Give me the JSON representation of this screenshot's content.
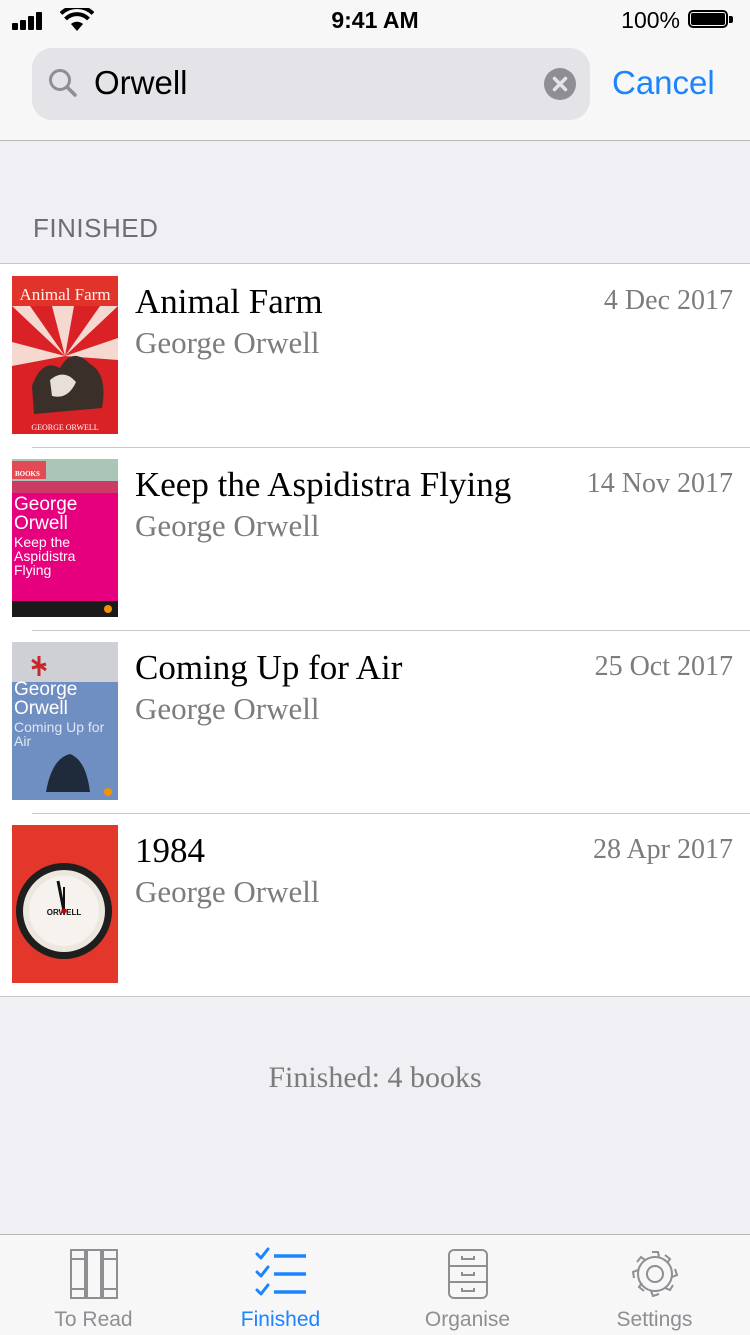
{
  "status_bar": {
    "time": "9:41 AM",
    "battery": "100%"
  },
  "search": {
    "query": "Orwell",
    "cancel_label": "Cancel"
  },
  "section": {
    "title": "FINISHED"
  },
  "books": [
    {
      "title": "Animal Farm",
      "author": "George Orwell",
      "date": "4 Dec 2017"
    },
    {
      "title": "Keep the Aspidistra Flying",
      "author": "George Orwell",
      "date": "14 Nov 2017"
    },
    {
      "title": "Coming Up for Air",
      "author": "George Orwell",
      "date": "25 Oct 2017"
    },
    {
      "title": "1984",
      "author": "George Orwell",
      "date": "28 Apr 2017"
    }
  ],
  "covers": {
    "animal_farm": {
      "heading": "Animal Farm",
      "footer": "GEORGE ORWELL"
    },
    "aspidistra": {
      "publisher": "BOOKS",
      "author": "George Orwell",
      "title": "Keep the Aspidistra Flying"
    },
    "coming_up": {
      "author": "George Orwell",
      "title": "Coming Up for Air"
    },
    "nineteen_84": {
      "clock_label": "ORWELL"
    }
  },
  "footer": {
    "count_text": "Finished: 4 books"
  },
  "tabs": [
    {
      "label": "To Read",
      "icon": "bookshelf-icon"
    },
    {
      "label": "Finished",
      "icon": "checklist-icon"
    },
    {
      "label": "Organise",
      "icon": "cabinet-icon"
    },
    {
      "label": "Settings",
      "icon": "gear-icon"
    }
  ],
  "colors": {
    "accent": "#1a85ff",
    "secondary_text": "#7c7c7c",
    "background": "#efeff4"
  }
}
